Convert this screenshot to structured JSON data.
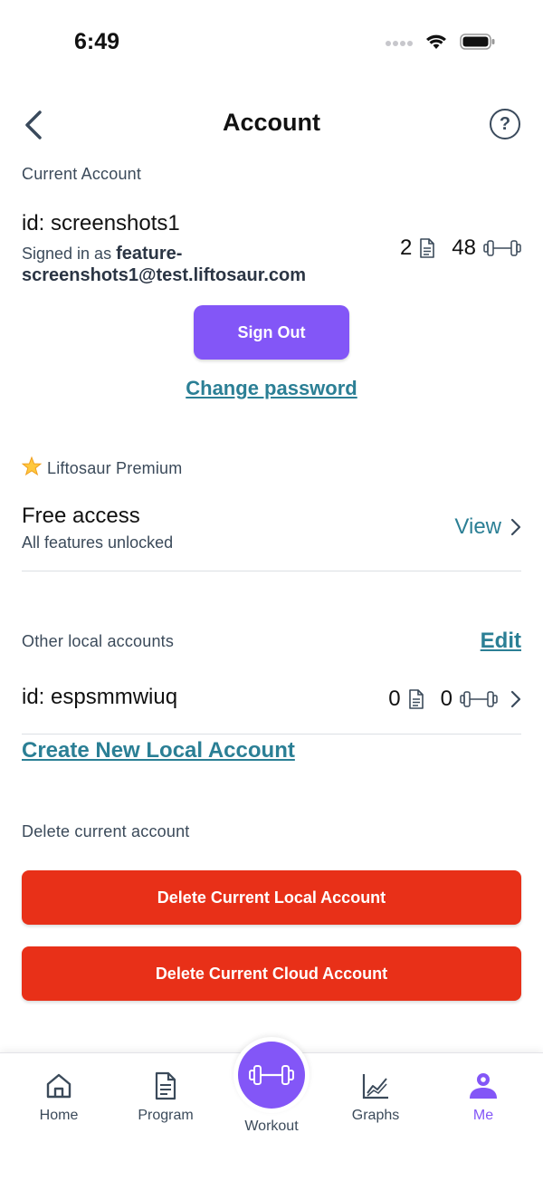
{
  "status_bar": {
    "time": "6:49"
  },
  "header": {
    "title": "Account",
    "help_symbol": "?"
  },
  "current_account": {
    "section_label": "Current Account",
    "id_text": "id: screenshots1",
    "signed_in_prefix": "Signed in as",
    "email": "feature-screenshots1@test.liftosaur.com",
    "programs_count": "2",
    "workouts_count": "48",
    "sign_out_label": "Sign Out",
    "change_password_label": "Change password"
  },
  "premium": {
    "section_label": "Liftosaur Premium",
    "icon": "star-icon",
    "title": "Free access",
    "subtitle": "All features unlocked",
    "view_label": "View"
  },
  "other_accounts": {
    "section_label": "Other local accounts",
    "edit_label": "Edit",
    "items": [
      {
        "id_text": "id: espsmmwiuq",
        "programs_count": "0",
        "workouts_count": "0"
      }
    ],
    "create_label": "Create New Local Account"
  },
  "delete": {
    "section_label": "Delete current account",
    "local_label": "Delete Current Local Account",
    "cloud_label": "Delete Current Cloud Account"
  },
  "tabbar": {
    "items": [
      {
        "label": "Home",
        "icon": "home-icon"
      },
      {
        "label": "Program",
        "icon": "document-icon"
      },
      {
        "label": "Workout",
        "icon": "dumbbell-icon"
      },
      {
        "label": "Graphs",
        "icon": "graph-icon"
      },
      {
        "label": "Me",
        "icon": "user-icon",
        "active": true
      }
    ]
  },
  "colors": {
    "accent": "#8356f7",
    "danger": "#e83018",
    "link": "#2b7f95",
    "text_muted": "#3b4a5a"
  }
}
